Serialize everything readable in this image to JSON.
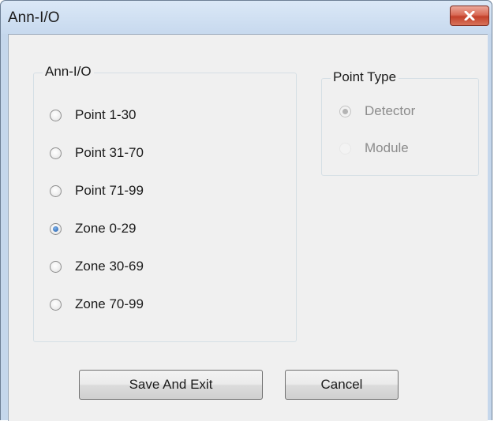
{
  "window": {
    "title": "Ann-I/O"
  },
  "ann_io_group": {
    "legend": "Ann-I/O",
    "options": [
      {
        "label": "Point 1-30",
        "checked": false
      },
      {
        "label": "Point 31-70",
        "checked": false
      },
      {
        "label": "Point 71-99",
        "checked": false
      },
      {
        "label": "Zone 0-29",
        "checked": true
      },
      {
        "label": "Zone 30-69",
        "checked": false
      },
      {
        "label": "Zone 70-99",
        "checked": false
      }
    ]
  },
  "point_type_group": {
    "legend": "Point Type",
    "options": [
      {
        "label": "Detector",
        "checked": true,
        "enabled": false
      },
      {
        "label": "Module",
        "checked": false,
        "enabled": false
      }
    ]
  },
  "buttons": {
    "save_label": "Save And Exit",
    "cancel_label": "Cancel"
  },
  "colors": {
    "close_button": "#c9452e",
    "checked_radio": "#1f5aa8",
    "disabled_text": "#8c8c8c"
  }
}
